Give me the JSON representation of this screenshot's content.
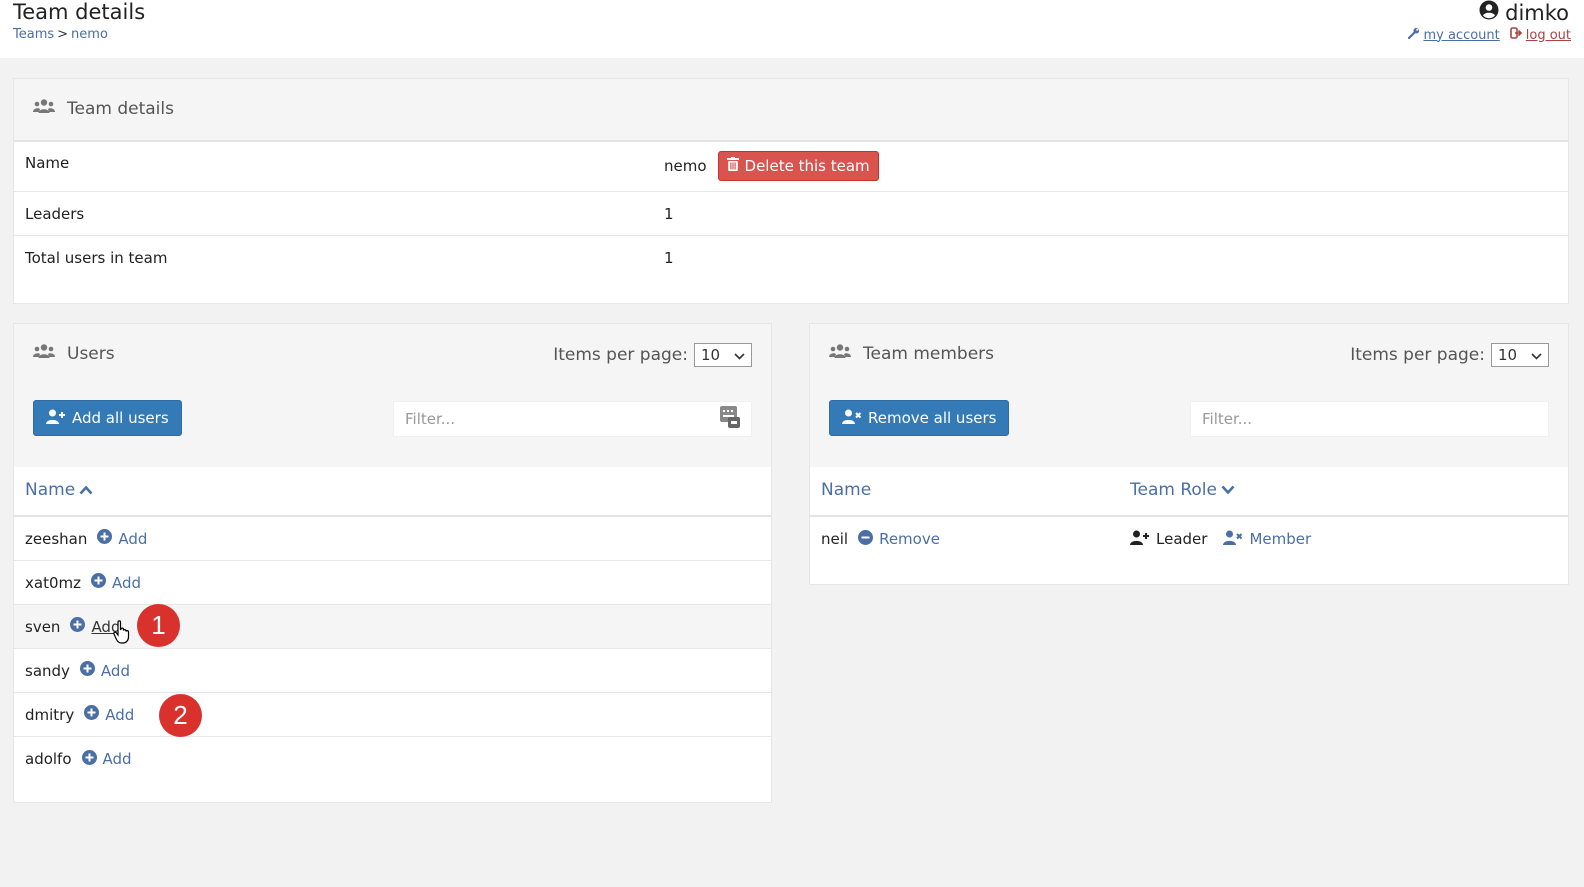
{
  "header": {
    "title": "Team details",
    "breadcrumb": {
      "root": "Teams",
      "separator": ">",
      "current": "nemo"
    },
    "user": "dimko",
    "my_account": "my account",
    "log_out": "log out"
  },
  "details": {
    "title": "Team details",
    "rows": [
      {
        "label": "Name",
        "value": "nemo"
      },
      {
        "label": "Leaders",
        "value": "1"
      },
      {
        "label": "Total users in team",
        "value": "1"
      }
    ],
    "delete_label": "Delete this team"
  },
  "users": {
    "title": "Users",
    "items_per_page_label": "Items per page:",
    "items_per_page": "10",
    "add_all_label": "Add all users",
    "filter_placeholder": "Filter...",
    "col_name": "Name",
    "add_label": "Add",
    "rows": [
      "zeeshan",
      "xat0mz",
      "sven",
      "sandy",
      "dmitry",
      "adolfo"
    ]
  },
  "members": {
    "title": "Team members",
    "items_per_page_label": "Items per page:",
    "items_per_page": "10",
    "remove_all_label": "Remove all users",
    "filter_placeholder": "Filter...",
    "col_name": "Name",
    "col_role": "Team Role",
    "rows": [
      {
        "name": "neil",
        "remove": "Remove",
        "role_leader": "Leader",
        "role_member": "Member"
      }
    ]
  },
  "annotations": {
    "step1": "1",
    "step2": "2"
  },
  "colors": {
    "primary": "#337ab7",
    "danger": "#d9534f",
    "link": "#4a6fa5",
    "badge": "#d9322d"
  }
}
